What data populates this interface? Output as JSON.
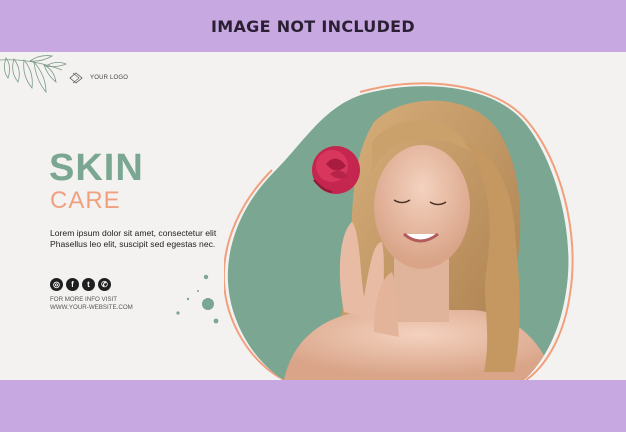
{
  "banner": {
    "top_text": "IMAGE NOT INCLUDED"
  },
  "logo": {
    "text": "YOUR LOGO"
  },
  "headline": {
    "line1": "SKIN",
    "line2": "CARE"
  },
  "description": "Lorem ipsum dolor sit amet, consectetur elit Phasellus leo elit, suscipit sed egestas nec.",
  "socials": [
    {
      "name": "instagram-icon",
      "glyph": "◎"
    },
    {
      "name": "facebook-icon",
      "glyph": "f"
    },
    {
      "name": "twitter-icon",
      "glyph": "t"
    },
    {
      "name": "whatsapp-icon",
      "glyph": "✆"
    }
  ],
  "contact": {
    "label": "FOR MORE INFO VISIT",
    "url": "WWW.YOUR-WEBSITE.COM"
  },
  "colors": {
    "band": "#c7a8e0",
    "blob": "#7aa692",
    "accent_peach": "#f1a07d",
    "heading_green": "#7aa692"
  }
}
